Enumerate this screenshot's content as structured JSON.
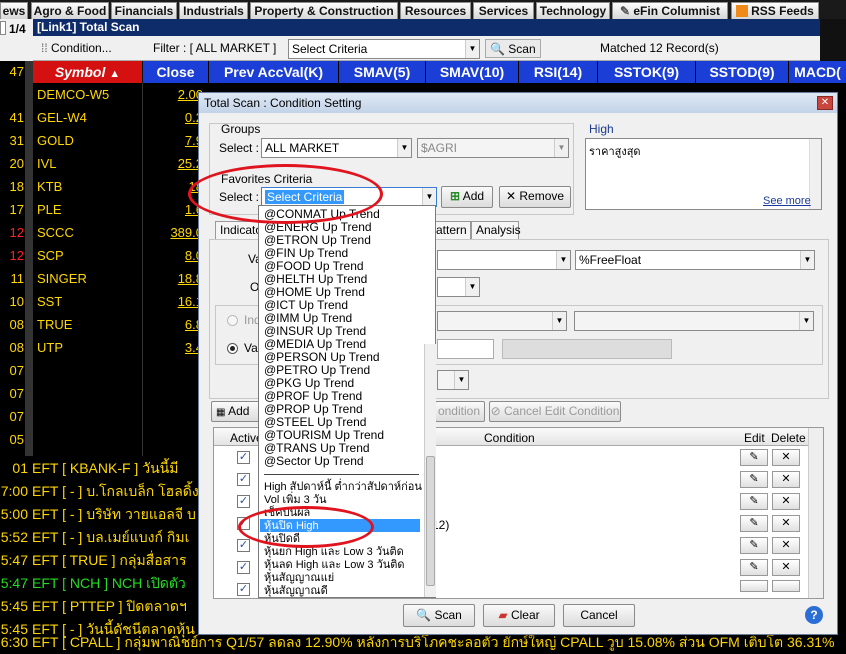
{
  "top_tabs": {
    "views": "ews",
    "agro": "Agro & Food",
    "financials": "Financials",
    "industrials": "Industrials",
    "property": "Property & Construction",
    "resources": "Resources",
    "services": "Services",
    "technology": "Technology",
    "columnist": "eFin Columnist",
    "rss": "RSS Feeds"
  },
  "window_title": "[Link1] Total Scan",
  "left_page_label": "1/4",
  "toolbar": {
    "condition_label": "Condition...",
    "filter_label": "Filter : [ ALL MARKET ]",
    "criteria_placeholder": "Select Criteria",
    "scan_label": "Scan",
    "matched_text": "Matched 12 Record(s)"
  },
  "grid": {
    "headers": [
      "Symbol",
      "Close",
      "Prev AccVal(K)",
      "SMAV(5)",
      "SMAV(10)",
      "RSI(14)",
      "SSTOK(9)",
      "SSTOD(9)",
      "MACD("
    ],
    "rows": [
      {
        "symbol": "DEMCO-W5",
        "close": "2.00",
        "time": "47"
      },
      {
        "symbol": "GEL-W4",
        "close": "0.2",
        "time": "41"
      },
      {
        "symbol": "GOLD",
        "close": "7.9",
        "time": "31"
      },
      {
        "symbol": "IVL",
        "close": "25.2",
        "time": "20"
      },
      {
        "symbol": "KTB",
        "close": "18",
        "time": "18"
      },
      {
        "symbol": "PLE",
        "close": "1.6",
        "time": "17"
      },
      {
        "symbol": "SCCC",
        "close": "389.0",
        "time": "12"
      },
      {
        "symbol": "SCP",
        "close": "8.0",
        "time": "12"
      },
      {
        "symbol": "SINGER",
        "close": "18.8",
        "time": "11"
      },
      {
        "symbol": "SST",
        "close": "16.1",
        "time": "10"
      },
      {
        "symbol": "TRUE",
        "close": "6.8",
        "time": "08"
      },
      {
        "symbol": "UTP",
        "close": "3.4",
        "time": "08"
      }
    ],
    "extra_times": [
      "07",
      "07",
      "07",
      "07",
      "05",
      "01"
    ]
  },
  "news": [
    {
      "time": "01",
      "text": "EFT  [ KBANK-F ]  วันนี้มี"
    },
    {
      "time": "7:00",
      "text": "EFT  [ - ]  บ.โกลเบล็ก โฮลดิ้ง"
    },
    {
      "time": "5:00",
      "text": "EFT  [ - ]  บริษัท วายแอลจี บ"
    },
    {
      "time": "5:52",
      "text": "EFT  [ - ]  บล.เมย์แบงก์ กิมเ"
    },
    {
      "time": "5:47",
      "text": "EFT  [ TRUE ]  กลุ่มสื่อสาร"
    },
    {
      "time": "5:47",
      "text": "EFT  [ NCH ]  NCH เปิดตัว"
    },
    {
      "time": "5:45",
      "text": "EFT  [ PTTEP ]  ปิดตลาดฯ"
    },
    {
      "time": "5:45",
      "text": "EFT  [ - ]  วันนี้ดัชนีตลาดหุ้น"
    },
    {
      "time": "6:30",
      "text": "EFT  [ CPALL ]  กลุ่มพาณิชย์การ Q1/57 ลดลง 12.90% หลังการบริโภคชะลอตัว ยักษ์ใหญ่ CPALL วูบ 15.08% ส่วน OFM เติบโต 36.31%"
    }
  ],
  "dialog": {
    "title": "Total Scan : Condition Setting",
    "groups_label": "Groups",
    "select_label": "Select :",
    "group_value": "ALL MARKET",
    "group_sub_value": "$AGRI",
    "high_label": "High",
    "high_text": "ราคาสูงสุด",
    "see_more": "See more",
    "favorites_label": "Favorites Criteria",
    "favorites_value": "Select Criteria",
    "add_label": "Add",
    "remove_label": "Remove",
    "tabs": [
      "Indicato",
      "attern",
      "Analysis"
    ],
    "val_label": "Va",
    "op_label": "Op",
    "indi_label": "Indi",
    "value_label": "Val",
    "free_float": "%FreeFloat",
    "add_cond_label": "Add",
    "edit_cond_label": "ondition",
    "cancel_edit_label": "Cancel Edit Condition",
    "table_headers": {
      "active": "Active",
      "condition": "Condition",
      "edit": "Edit",
      "delete": "Delete"
    },
    "visible_condition_fragment": "12)",
    "scan_btn": "Scan",
    "clear_btn": "Clear",
    "cancel_btn": "Cancel"
  },
  "criteria_list": [
    "@CONMAT Up Trend",
    "@ENERG Up Trend",
    "@ETRON Up Trend",
    "@FIN Up Trend",
    "@FOOD Up Trend",
    "@HELTH Up Trend",
    "@HOME Up Trend",
    "@ICT Up Trend",
    "@IMM Up Trend",
    "@INSUR Up Trend",
    "@MEDIA Up Trend",
    "@PERSON Up Trend",
    "@PETRO Up Trend",
    "@PKG Up Trend",
    "@PROF Up Trend",
    "@PROP Up Trend",
    "@STEEL Up Trend",
    "@TOURISM Up Trend",
    "@TRANS Up Trend",
    "@Sector Up Trend",
    "High สัปดาห์นี้ ต่ำกว่าสัปดาห์ก่อน",
    "Vol เพิ่ม 3 วัน",
    "เช็คปันผล",
    "หุ้นปิด High",
    "หุ้นปิดดี",
    "หุ้นยก High และ Low 3 วันติด",
    "หุ้นลด High และ Low 3 วันติด",
    "หุ้นสัญญาณแย่",
    "หุ้นสัญญาณดี"
  ],
  "colors": {
    "accent": "#1b3ed6",
    "symbol_text": "#ffd700",
    "highlight": "#3399ff",
    "circle": "#e0141e"
  }
}
